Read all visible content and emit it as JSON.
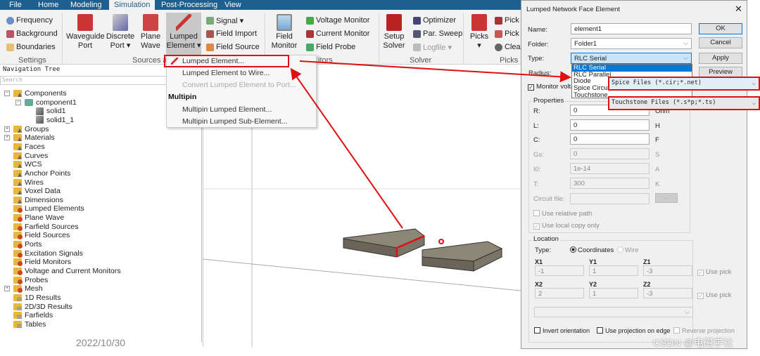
{
  "tabs": [
    "File",
    "Home",
    "Modeling",
    "Simulation",
    "Post-Processing",
    "View"
  ],
  "ribbon": {
    "settings": {
      "items": [
        "Frequency",
        "Background",
        "Boundaries"
      ],
      "label": "Settings"
    },
    "sources": {
      "waveguide": "Waveguide",
      "waveguide2": "Port",
      "discrete": "Discrete",
      "discrete2": "Port ▾",
      "plane": "Plane",
      "plane2": "Wave",
      "lumped": "Lumped",
      "lumped2": "Element ▾",
      "small": [
        "Signal ▾",
        "Field Import",
        "Field Source"
      ],
      "label": "Sources a"
    },
    "monitors": {
      "field": "Field",
      "field2": "Monitor",
      "small": [
        "Voltage Monitor",
        "Current Monitor",
        "Field Probe"
      ],
      "label": "itors"
    },
    "solver": {
      "setup": "Setup",
      "setup2": "Solver",
      "small": [
        "Optimizer",
        "Par. Sweep",
        "Logfile ▾"
      ],
      "label": "Solver"
    },
    "picks": {
      "big": "Picks",
      "big2": "▾",
      "small": [
        "Pick",
        "Pick",
        "Clea"
      ],
      "label": "Picks"
    }
  },
  "menu": {
    "items": [
      "Lumped Element...",
      "Lumped Element to Wire...",
      "Convert Lumped Element to Port..."
    ],
    "header": "Multipin",
    "multipin": [
      "Multipin Lumped Element...",
      "Multipin Lumped Sub-Element..."
    ]
  },
  "nav": {
    "title": "Navigation Tree",
    "search_placeholder": "Search",
    "tree": [
      "Components",
      "component1",
      "solid1",
      "solid1_1",
      "Groups",
      "Materials",
      "Faces",
      "Curves",
      "WCS",
      "Anchor Points",
      "Wires",
      "Voxel Data",
      "Dimensions",
      "Lumped Elements",
      "Plane Wave",
      "Farfield Sources",
      "Field Sources",
      "Ports",
      "Excitation Signals",
      "Field Monitors",
      "Voltage and Current Monitors",
      "Probes",
      "Mesh",
      "1D Results",
      "2D/3D Results",
      "Farfields",
      "Tables"
    ]
  },
  "date": "2022/10/30",
  "dialog": {
    "title": "Lumped Network Face Element",
    "close": "✕",
    "name_label": "Name:",
    "name": "element1",
    "folder_label": "Folder:",
    "folder": "Folder1",
    "type_label": "Type:",
    "type": "RLC Serial",
    "radius_label": "Radius:",
    "type_options": [
      "RLC Serial",
      "RLC Parallel",
      "Diode",
      "Spice Circuit",
      "Touchstone"
    ],
    "monitor": "Monitor volta",
    "buttons": {
      "ok": "OK",
      "cancel": "Cancel",
      "apply": "Apply",
      "preview": "Preview"
    },
    "properties": {
      "title": "Properties",
      "r": "R:",
      "r_val": "0",
      "r_unit": "Ohm",
      "l": "L:",
      "l_val": "0",
      "l_unit": "H",
      "c": "C:",
      "c_val": "0",
      "c_unit": "F",
      "gs": "Gs:",
      "gs_val": "0",
      "gs_unit": "S",
      "i0": "I0:",
      "i0_val": "1e-14",
      "i0_unit": "A",
      "t": "T:",
      "t_val": "300",
      "t_unit": "K",
      "circuit": "Circuit file:",
      "browse": "...",
      "relpath": "Use relative path",
      "localcopy": "Use local copy only"
    },
    "location": {
      "title": "Location",
      "type_label": "Type:",
      "coords": "Coordinates",
      "wire": "Wire",
      "x1": "X1",
      "y1": "Y1",
      "z1": "Z1",
      "x1v": "-1",
      "y1v": "1",
      "z1v": "-3",
      "x2": "X2",
      "y2": "Y2",
      "z2": "Z2",
      "x2v": "2",
      "y2v": "1",
      "z2v": "-3",
      "usepick": "Use pick",
      "invert": "Invert orientation",
      "projection": "Use projection on edge",
      "reverse": "Reverse projection"
    }
  },
  "callouts": {
    "spice": "Spice Files (*.cir;*.net)",
    "touchstone": "Touchstone Files (*.s*p;*.ts)"
  },
  "watermark": "CSDN @电磁学社",
  "colors": {
    "tabbar": "#1d5f8f",
    "highlight": "#0078d7",
    "annotation": "#e01010"
  }
}
